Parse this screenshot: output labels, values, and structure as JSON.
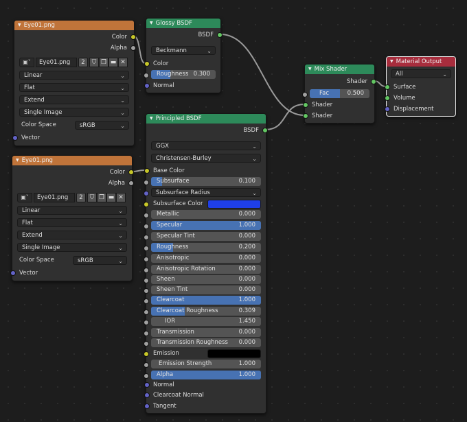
{
  "image_tex_1": {
    "title": "Eye01.png",
    "outputs": [
      "Color",
      "Alpha"
    ],
    "image_name": "Eye01.png",
    "users": "2",
    "interpolation": "Linear",
    "projection": "Flat",
    "extension": "Extend",
    "source": "Single Image",
    "color_space_label": "Color Space",
    "color_space": "sRGB",
    "input": "Vector"
  },
  "image_tex_2": {
    "title": "Eye01.png",
    "outputs": [
      "Color",
      "Alpha"
    ],
    "image_name": "Eye01.png",
    "users": "2",
    "interpolation": "Linear",
    "projection": "Flat",
    "extension": "Extend",
    "source": "Single Image",
    "color_space_label": "Color Space",
    "color_space": "sRGB",
    "input": "Vector"
  },
  "glossy": {
    "title": "Glossy BSDF",
    "output": "BSDF",
    "distribution": "Beckmann",
    "color_label": "Color",
    "roughness_label": "Roughness",
    "roughness_value": "0.300",
    "roughness_fraction": 0.3,
    "normal_label": "Normal"
  },
  "mix": {
    "title": "Mix Shader",
    "output": "Shader",
    "fac_label": "Fac",
    "fac_value": "0.500",
    "fac_fraction": 0.5,
    "shader1": "Shader",
    "shader2": "Shader"
  },
  "material_output": {
    "title": "Material Output",
    "target": "All",
    "inputs": [
      "Surface",
      "Volume",
      "Displacement"
    ]
  },
  "principled": {
    "title": "Principled BSDF",
    "output": "BSDF",
    "distribution": "GGX",
    "subsurface_method": "Christensen-Burley",
    "base_color_label": "Base Color",
    "subsurface_label": "Subsurface",
    "subsurface_value": "0.100",
    "subsurface_radius_label": "Subsurface Radius",
    "subsurface_color_label": "Subsurface Color",
    "subsurface_color": "#1f3fe8",
    "metallic_label": "Metallic",
    "metallic_value": "0.000",
    "specular_label": "Specular",
    "specular_value": "1.000",
    "specular_tint_label": "Specular Tint",
    "specular_tint_value": "0.000",
    "roughness_label": "Roughness",
    "roughness_value": "0.200",
    "anisotropic_label": "Anisotropic",
    "anisotropic_value": "0.000",
    "aniso_rot_label": "Anisotropic Rotation",
    "aniso_rot_value": "0.000",
    "sheen_label": "Sheen",
    "sheen_value": "0.000",
    "sheen_tint_label": "Sheen Tint",
    "sheen_tint_value": "0.000",
    "clearcoat_label": "Clearcoat",
    "clearcoat_value": "1.000",
    "cc_rough_label": "Clearcoat Roughness",
    "cc_rough_value": "0.309",
    "ior_label": "IOR",
    "ior_value": "1.450",
    "transmission_label": "Transmission",
    "transmission_value": "0.000",
    "trans_rough_label": "Transmission Roughness",
    "trans_rough_value": "0.000",
    "emission_label": "Emission",
    "emission_color": "#000000",
    "emission_strength_label": "Emission Strength",
    "emission_strength_value": "1.000",
    "alpha_label": "Alpha",
    "alpha_value": "1.000",
    "normal_label": "Normal",
    "clearcoat_normal_label": "Clearcoat Normal",
    "tangent_label": "Tangent"
  },
  "colors": {
    "accent_blue": "#4772b3",
    "header_texture": "#c0743a",
    "header_shader": "#2d8a5a",
    "header_output": "#a82d3d"
  }
}
